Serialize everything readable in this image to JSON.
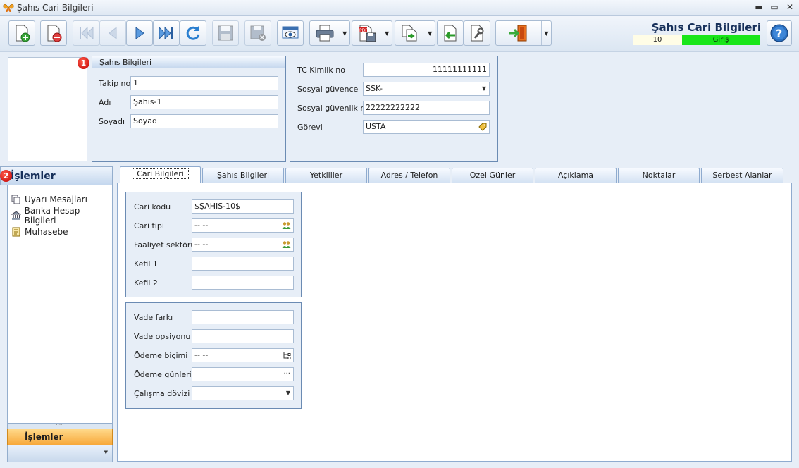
{
  "window": {
    "title": "Şahıs Cari Bilgileri",
    "minimize": "▬",
    "maximize": "▭",
    "close": "✕"
  },
  "toolbar": {
    "buttons": [
      {
        "icon": "new-document-icon",
        "enabled": true
      },
      {
        "icon": "delete-document-icon",
        "enabled": true
      },
      {
        "icon": "first-record-icon",
        "enabled": false
      },
      {
        "icon": "previous-record-icon",
        "enabled": false
      },
      {
        "icon": "next-record-icon",
        "enabled": true
      },
      {
        "icon": "last-record-icon",
        "enabled": true
      },
      {
        "icon": "refresh-icon",
        "enabled": true
      },
      {
        "icon": "save-icon",
        "enabled": false
      },
      {
        "icon": "cancel-save-icon",
        "enabled": false
      },
      {
        "icon": "preview-icon",
        "enabled": true
      },
      {
        "icon": "print-icon",
        "enabled": true
      },
      {
        "icon": "pdf-export-icon",
        "enabled": true
      },
      {
        "icon": "copy-document-icon",
        "enabled": true
      },
      {
        "icon": "import-icon",
        "enabled": true
      },
      {
        "icon": "settings-wrench-icon",
        "enabled": true
      },
      {
        "icon": "exit-door-icon",
        "enabled": true
      }
    ]
  },
  "header": {
    "title": "Şahıs Cari Bilgileri",
    "record_number": "10",
    "mode": "Giriş",
    "mode_color": "#19e619"
  },
  "badges": {
    "one": "1",
    "two": "2"
  },
  "person": {
    "group_title": "Şahıs Bilgileri",
    "takip_no_label": "Takip no",
    "takip_no": "1",
    "adi_label": "Adı",
    "adi": "Şahıs-1",
    "soyadi_label": "Soyadı",
    "soyadi": "Soyad"
  },
  "identity": {
    "tc_label": "TC Kimlik no",
    "tc": "11111111111",
    "sgk_label": "Sosyal güvence",
    "sgk": "SSK-",
    "sgk_no_label": "Sosyal güvenlik no",
    "sgk_no": "22222222222",
    "gorev_label": "Görevi",
    "gorev": "USTA"
  },
  "operations": {
    "title": "İşlemler",
    "items": [
      "Uyarı Mesajları",
      "Banka Hesap Bilgileri",
      "Muhasebe"
    ],
    "selected_pane": "İşlemler",
    "grip": "·····"
  },
  "tabs": [
    "Cari Bilgileri",
    "Şahıs Bilgileri",
    "Yetkililer",
    "Adres / Telefon",
    "Özel Günler",
    "Açıklama",
    "Noktalar",
    "Serbest Alanlar"
  ],
  "cari": {
    "cari_kodu_label": "Cari kodu",
    "cari_kodu": "$ŞAHIS-10$",
    "cari_tipi_label": "Cari tipi",
    "cari_tipi": "-- --",
    "faaliyet_label": "Faaliyet sektörü",
    "faaliyet": "-- --",
    "kefil1_label": "Kefil 1",
    "kefil1": "",
    "kefil2_label": "Kefil 2",
    "kefil2": "",
    "vade_farki_label": "Vade farkı",
    "vade_farki": "",
    "vade_ops_label": "Vade opsiyonu",
    "vade_ops": "",
    "odeme_bicimi_label": "Ödeme biçimi",
    "odeme_bicimi": "-- --",
    "odeme_gun_label": "Ödeme günleri",
    "odeme_gun": "",
    "ellipsis": "···",
    "doviz_label": "Çalışma dövizi",
    "doviz": ""
  }
}
